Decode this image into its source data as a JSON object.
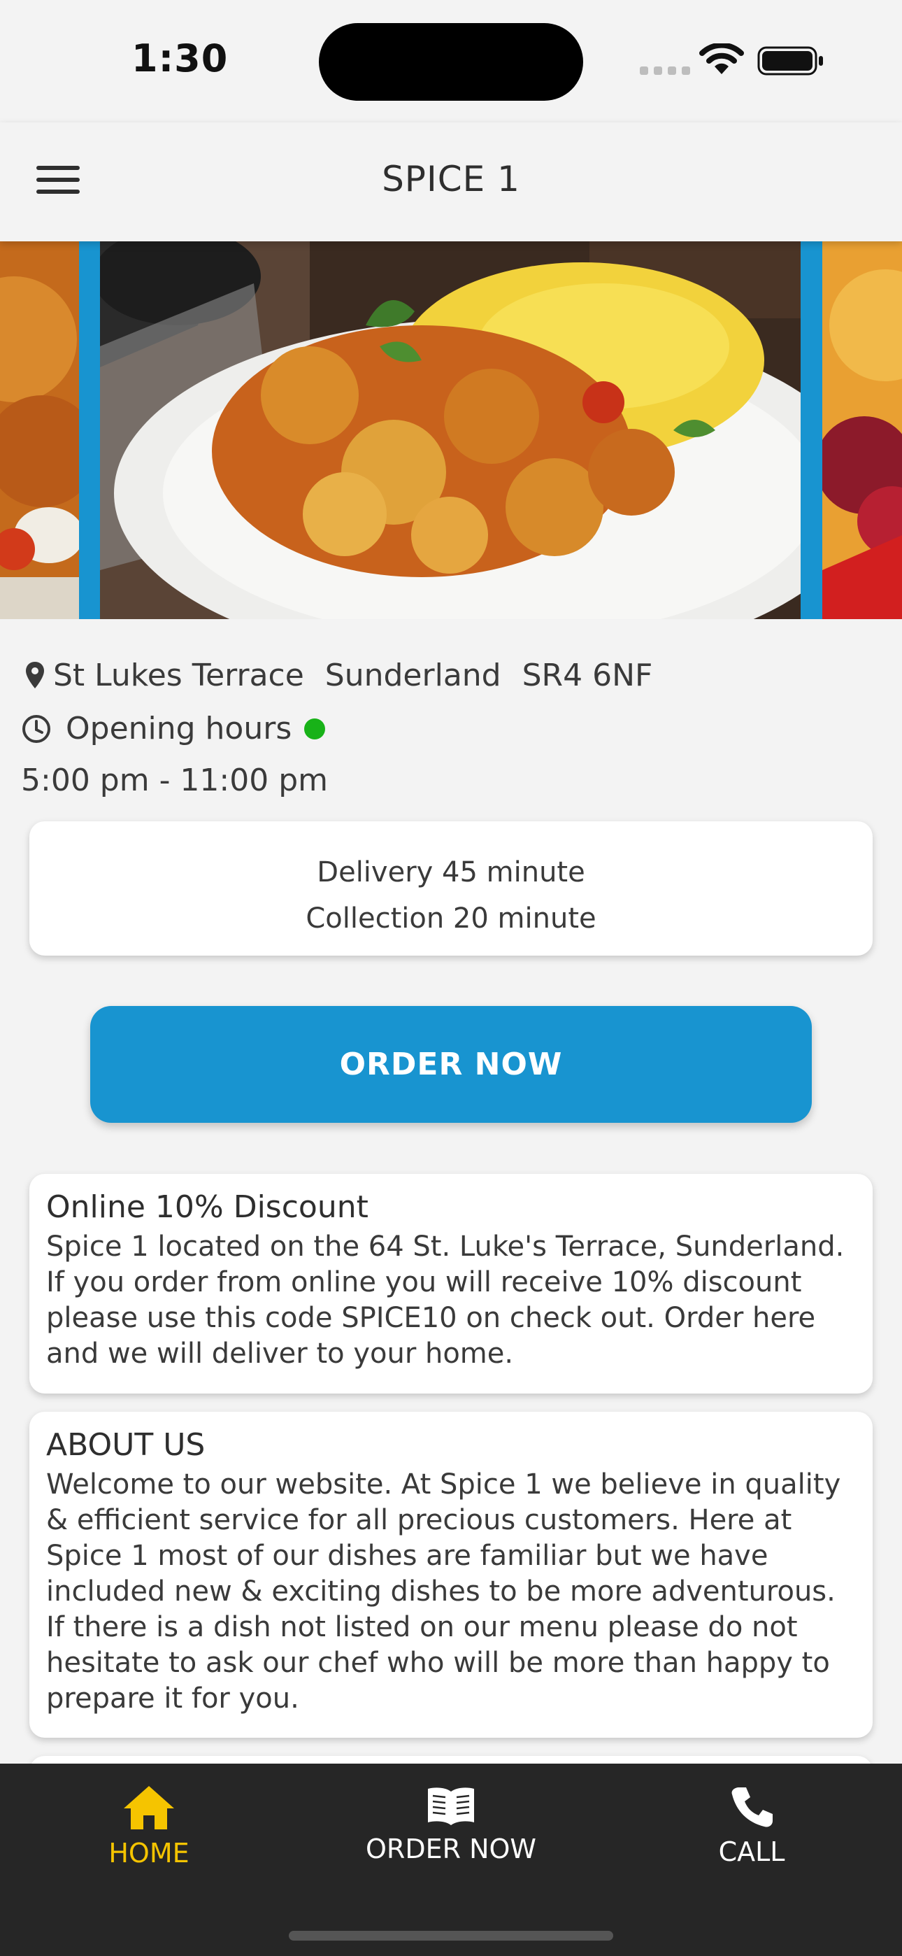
{
  "status_bar": {
    "time": "1:30"
  },
  "header": {
    "title": "SPICE 1",
    "menu_icon": "hamburger-menu-icon"
  },
  "carousel": {
    "images": [
      "curry-dish-left",
      "curry-with-rice-main",
      "curry-dish-right"
    ],
    "accent": "#1894d0"
  },
  "location": {
    "icon": "map-pin-icon",
    "street": "St Lukes Terrace",
    "city": "Sunderland",
    "postcode": "SR4 6NF"
  },
  "hours": {
    "icon": "clock-icon",
    "label": "Opening hours",
    "status_color": "#18b218",
    "time": "5:00 pm - 11:00 pm"
  },
  "times": {
    "delivery": "Delivery 45 minute",
    "collection": "Collection 20 minute"
  },
  "order_button": {
    "label": "ORDER NOW",
    "color": "#1894d0"
  },
  "discount": {
    "title": "Online 10% Discount",
    "body": "Spice 1 located on the 64 St. Luke's Terrace, Sunderland. If you order from online you will receive 10% discount please use this code SPICE10 on check out. Order here and we will deliver to your home."
  },
  "about": {
    "title": "ABOUT US",
    "body": "Welcome to our website. At Spice 1 we believe in quality & efficient service for all precious customers. Here at Spice 1 most of our dishes are familiar but we have included new & exciting dishes to be more adventurous. If there is a dish not listed on our menu please do not hesitate to ask our chef who will be more than happy to prepare it for you."
  },
  "bottom_nav": {
    "items": [
      {
        "label": "HOME",
        "icon": "home-icon",
        "active": true
      },
      {
        "label": "ORDER NOW",
        "icon": "book-icon",
        "active": false
      },
      {
        "label": "CALL",
        "icon": "phone-icon",
        "active": false
      }
    ],
    "active_color": "#f5c400"
  }
}
